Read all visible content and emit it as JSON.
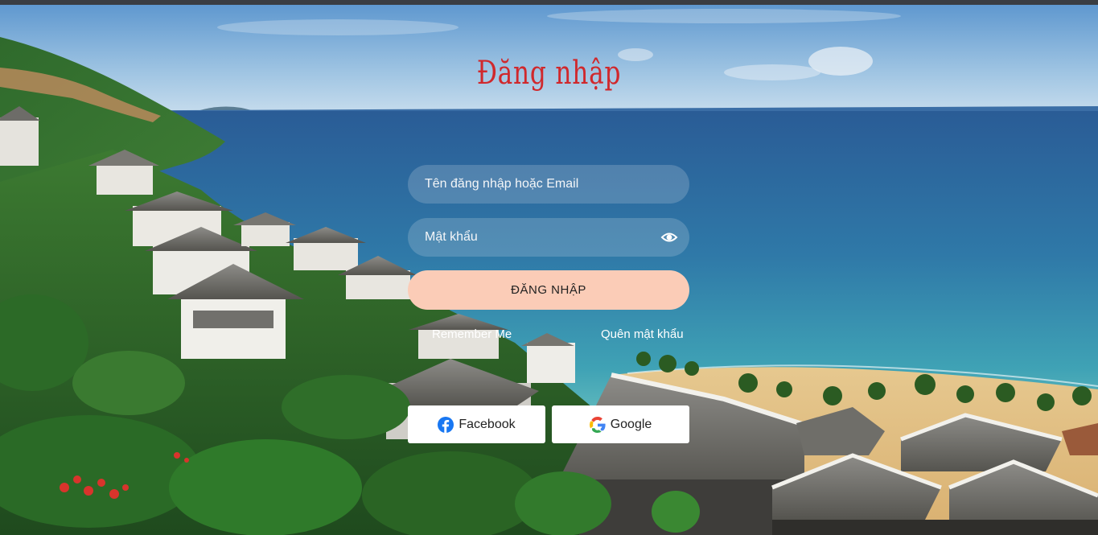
{
  "login": {
    "title": "Đăng nhập",
    "username_placeholder": "Tên đăng nhập hoặc Email",
    "password_placeholder": "Mật khẩu",
    "submit_label": "ĐĂNG NHẬP",
    "remember_label": "Remember Me",
    "forgot_label": "Quên mật khẩu"
  },
  "social": {
    "facebook_label": "Facebook",
    "google_label": "Google"
  },
  "icons": {
    "password_toggle": "eye-icon",
    "facebook": "facebook-icon",
    "google": "google-icon"
  },
  "colors": {
    "title": "#d0282c",
    "submit_button": "#fbccb7",
    "facebook_blue": "#1877f2"
  }
}
